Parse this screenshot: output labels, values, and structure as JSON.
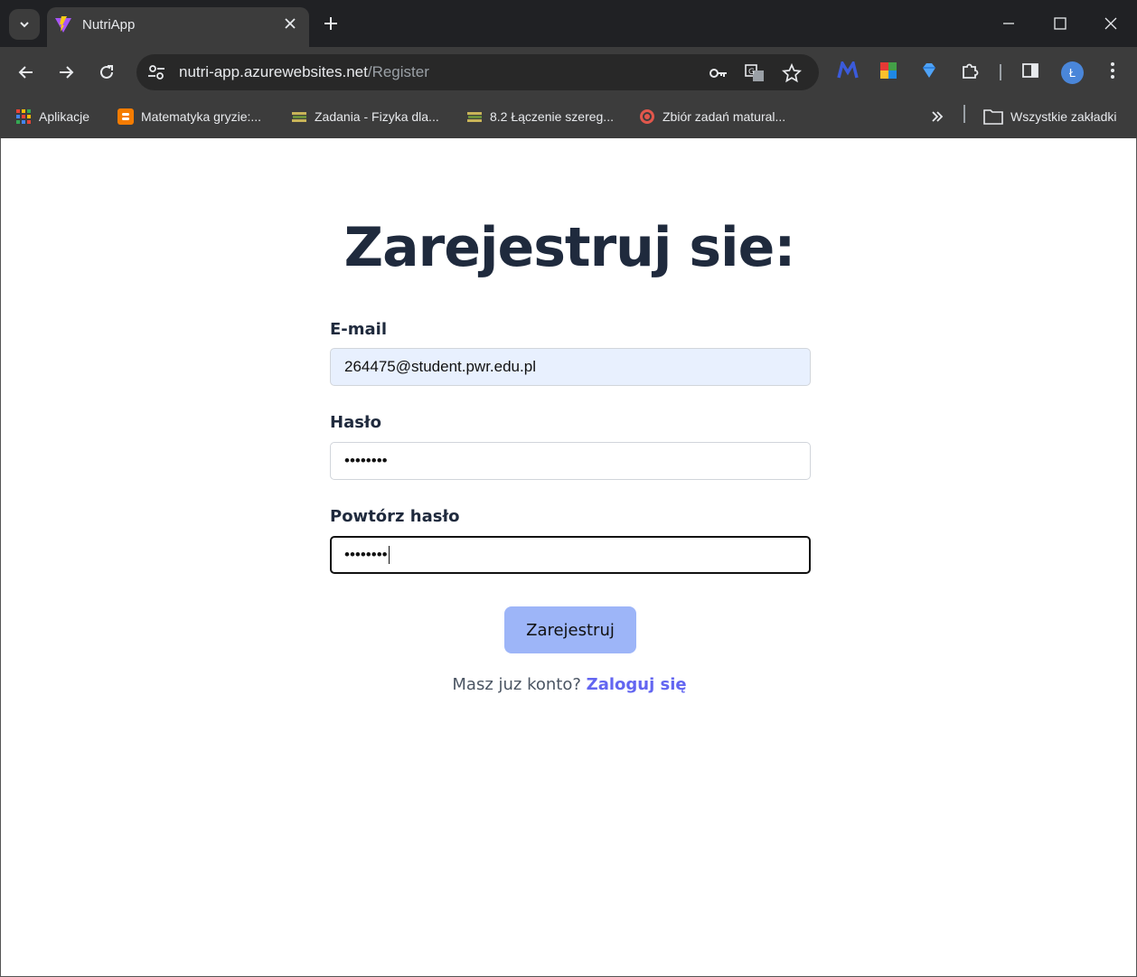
{
  "browser": {
    "tab": {
      "title": "NutriApp"
    },
    "address": {
      "host": "nutri-app.azurewebsites.net",
      "path": "/Register"
    },
    "profile_initial": "Ł",
    "bookmarks": [
      {
        "label": "Aplikacje",
        "icon": "apps-grid-icon"
      },
      {
        "label": "Matematyka gryzie:...",
        "icon": "blogger-icon"
      },
      {
        "label": "Zadania - Fizyka dla...",
        "icon": "book-stack-icon"
      },
      {
        "label": "8.2 Łączenie szereg...",
        "icon": "book-stack-icon"
      },
      {
        "label": "Zbiór zadań matural...",
        "icon": "target-icon"
      }
    ],
    "all_bookmarks_label": "Wszystkie zakładki"
  },
  "register": {
    "heading": "Zarejestruj sie:",
    "email_label": "E-mail",
    "email_value": "264475@student.pwr.edu.pl",
    "password_label": "Hasło",
    "password_value": "••••••••",
    "repeat_label": "Powtórz hasło",
    "repeat_value": "••••••••",
    "submit_label": "Zarejestruj",
    "login_prompt": "Masz juz konto?",
    "login_link": "Zaloguj się"
  },
  "colors": {
    "heading": "#1f2a3d",
    "button": "#9db5f8",
    "link": "#6366f1",
    "autofill": "#e8f0fe"
  }
}
